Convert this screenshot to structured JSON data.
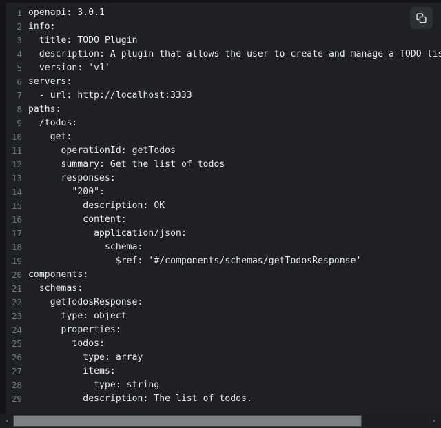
{
  "editor": {
    "language": "yaml",
    "background_color": "#1e2023",
    "text_color": "#e8eaed",
    "line_number_color": "#72767c",
    "lines": [
      {
        "n": "1",
        "text": "openapi: 3.0.1"
      },
      {
        "n": "2",
        "text": "info:"
      },
      {
        "n": "3",
        "text": "  title: TODO Plugin"
      },
      {
        "n": "4",
        "text": "  description: A plugin that allows the user to create and manage a TODO list u"
      },
      {
        "n": "5",
        "text": "  version: 'v1'"
      },
      {
        "n": "6",
        "text": "servers:"
      },
      {
        "n": "7",
        "text": "  - url: http://localhost:3333"
      },
      {
        "n": "8",
        "text": "paths:"
      },
      {
        "n": "9",
        "text": "  /todos:"
      },
      {
        "n": "10",
        "text": "    get:"
      },
      {
        "n": "11",
        "text": "      operationId: getTodos"
      },
      {
        "n": "12",
        "text": "      summary: Get the list of todos"
      },
      {
        "n": "13",
        "text": "      responses:"
      },
      {
        "n": "14",
        "text": "        \"200\":"
      },
      {
        "n": "15",
        "text": "          description: OK"
      },
      {
        "n": "16",
        "text": "          content:"
      },
      {
        "n": "17",
        "text": "            application/json:"
      },
      {
        "n": "18",
        "text": "              schema:"
      },
      {
        "n": "19",
        "text": "                $ref: '#/components/schemas/getTodosResponse'"
      },
      {
        "n": "20",
        "text": "components:"
      },
      {
        "n": "21",
        "text": "  schemas:"
      },
      {
        "n": "22",
        "text": "    getTodosResponse:"
      },
      {
        "n": "23",
        "text": "      type: object"
      },
      {
        "n": "24",
        "text": "      properties:"
      },
      {
        "n": "25",
        "text": "        todos:"
      },
      {
        "n": "26",
        "text": "          type: array"
      },
      {
        "n": "27",
        "text": "          items:"
      },
      {
        "n": "28",
        "text": "            type: string"
      },
      {
        "n": "29",
        "text": "          description: The list of todos."
      }
    ]
  },
  "toolbar": {
    "copy_button_label": "Copy",
    "copy_icon": "copy-icon"
  },
  "scrollbar": {
    "left_arrow_glyph": "‹",
    "right_arrow_glyph": "›",
    "left_arrow_icon": "chevron-left-icon",
    "right_arrow_icon": "chevron-right-icon",
    "orientation": "horizontal",
    "thumb_color": "#7d8084",
    "track_color": "#1c1e21"
  }
}
